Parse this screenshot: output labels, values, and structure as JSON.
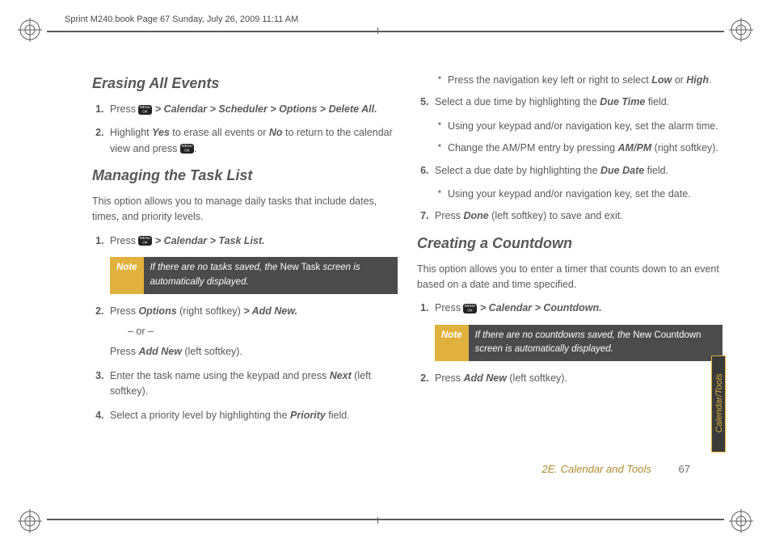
{
  "header": "Sprint M240.book  Page 67  Sunday, July 26, 2009  11:11 AM",
  "footer": {
    "section": "2E. Calendar and Tools",
    "page": "67"
  },
  "sidetab": "Calendar/Tools",
  "c1": {
    "h_erase": "Erasing All Events",
    "erase_1a": "Press ",
    "erase_1b": " > Calendar > Scheduler > Options > Delete All.",
    "erase_2a": "Highlight ",
    "erase_2b": "Yes",
    "erase_2c": " to erase all events or ",
    "erase_2d": "No",
    "erase_2e": " to return to the calendar view and press ",
    "erase_2f": ".",
    "h_task": "Managing the Task List",
    "task_intro": "This option allows you to manage daily tasks that include dates, times, and priority levels.",
    "task_1a": "Press ",
    "task_1b": " > Calendar > Task List.",
    "note1_label": "Note",
    "note1_a": "If there are no tasks saved, the ",
    "note1_b": "New Task",
    "note1_c": " screen is automatically displayed.",
    "task_2a": "Press ",
    "task_2b": "Options",
    "task_2c": " (right softkey) ",
    "task_2d": "> Add New.",
    "task_2or": "– or –",
    "task_2e": "Press ",
    "task_2f": "Add New",
    "task_2g": " (left softkey).",
    "task_3a": "Enter the task name using the keypad and press ",
    "task_3b": "Next",
    "task_3c": " (left softkey).",
    "task_4a": "Select a priority level by highlighting the ",
    "task_4b": "Priority",
    "task_4c": " field."
  },
  "c2": {
    "sub1a": "Press the navigation key left or right to select ",
    "sub1b": "Low",
    "sub1c": " or ",
    "sub1d": "High",
    "sub1e": ".",
    "s5a": "Select a due time by highlighting the ",
    "s5b": "Due Time",
    "s5c": " field.",
    "sub2": "Using your keypad and/or navigation key, set the alarm time.",
    "sub3a": "Change the AM/PM entry by pressing ",
    "sub3b": "AM/PM",
    "sub3c": " (right softkey).",
    "s6a": "Select a due date by highlighting the ",
    "s6b": "Due Date",
    "s6c": " field.",
    "sub4": "Using your keypad and/or navigation key, set the date.",
    "s7a": "Press ",
    "s7b": "Done",
    "s7c": " (left softkey) to save and exit.",
    "h_count": "Creating a Countdown",
    "count_intro": "This option allows you to enter a timer that counts down to an event based on a date and time specified.",
    "count_1a": "Press ",
    "count_1b": " > Calendar > Countdown.",
    "note2_label": "Note",
    "note2_a": "If there are no countdowns saved, the ",
    "note2_b": "New Countdown",
    "note2_c": " screen is automatically displayed.",
    "count_2a": "Press ",
    "count_2b": "Add New",
    "count_2c": " (left softkey)."
  }
}
